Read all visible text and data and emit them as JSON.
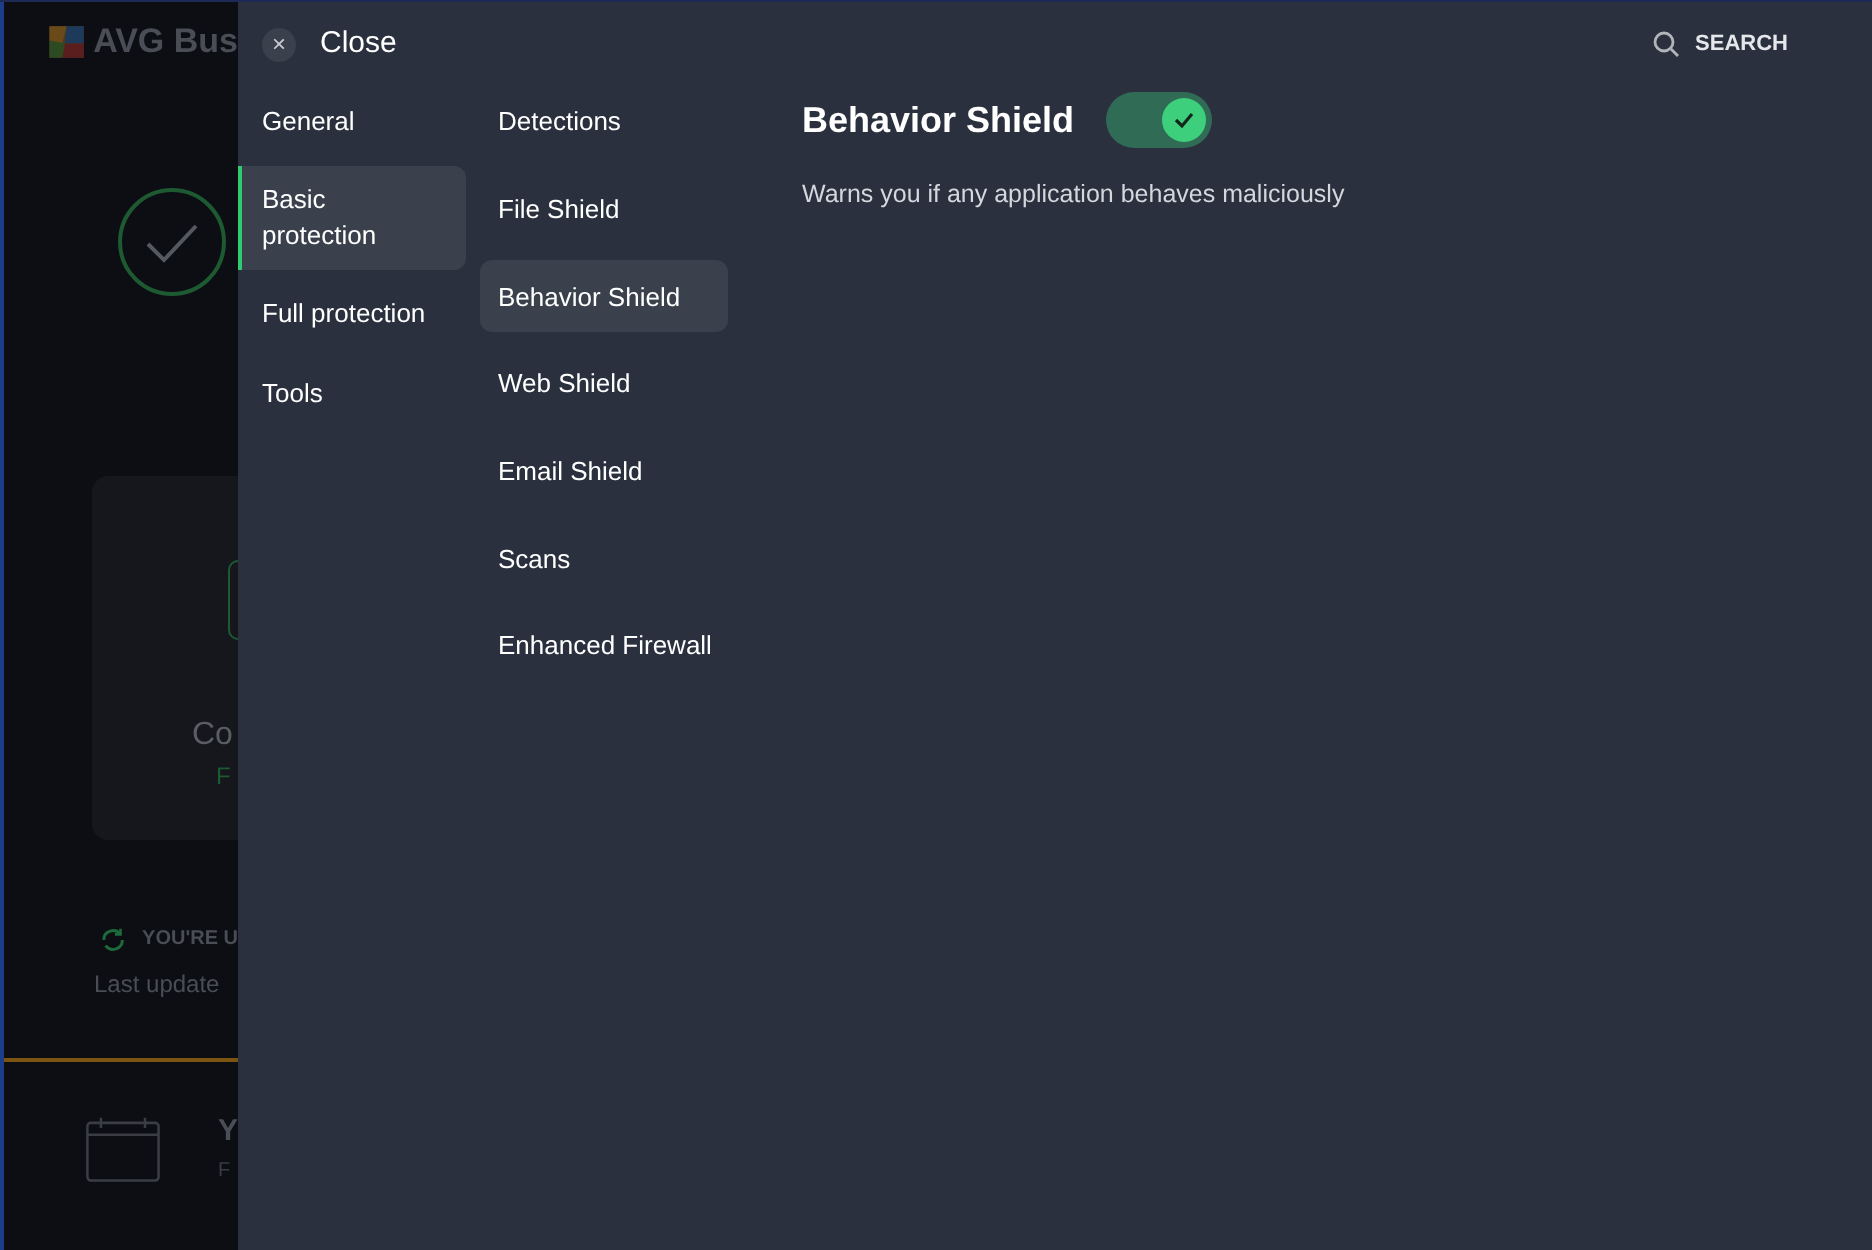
{
  "background_app": {
    "title": "AVG Bus",
    "card_title": "Co",
    "card_status": "F",
    "update_status": "YOU'RE U",
    "last_updated": "Last update",
    "schedule_title": "Y",
    "schedule_subtitle": "F"
  },
  "header": {
    "close_icon": "×",
    "close_label": "Close",
    "search_label": "SEARCH"
  },
  "categories": [
    {
      "label": "General",
      "selected": false
    },
    {
      "label": "Basic protection",
      "selected": true
    },
    {
      "label": "Full protection",
      "selected": false
    },
    {
      "label": "Tools",
      "selected": false
    }
  ],
  "subcategories": [
    {
      "label": "Detections",
      "selected": false
    },
    {
      "label": "File Shield",
      "selected": false
    },
    {
      "label": "Behavior Shield",
      "selected": true
    },
    {
      "label": "Web Shield",
      "selected": false
    },
    {
      "label": "Email Shield",
      "selected": false
    },
    {
      "label": "Scans",
      "selected": false
    },
    {
      "label": "Enhanced Firewall",
      "selected": false
    }
  ],
  "content": {
    "title": "Behavior Shield",
    "toggle_on": true,
    "description": "Warns you if any application behaves maliciously"
  }
}
